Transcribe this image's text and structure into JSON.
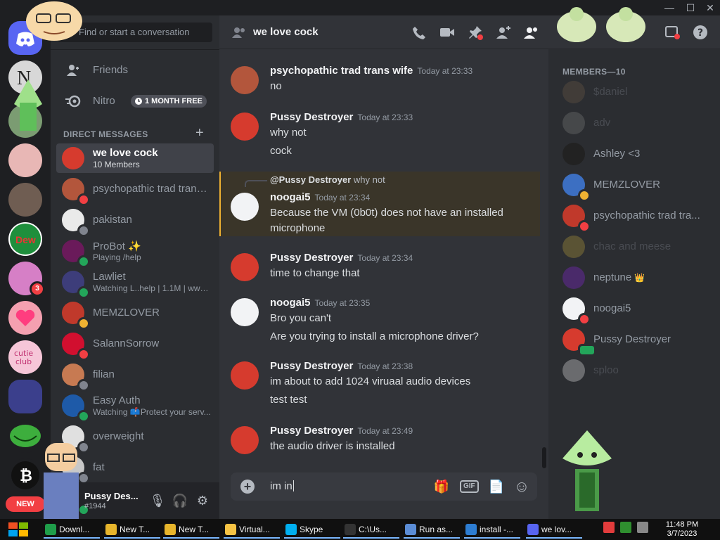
{
  "window": {
    "controls": {
      "minimize": "—",
      "maximize": "☐",
      "close": "✕"
    }
  },
  "colors": {
    "blurple": "#5865f2",
    "online": "#23a55a",
    "dnd": "#f23f43",
    "idle": "#f0b232",
    "mention_highlight": "#f0b232"
  },
  "rail": {
    "mention_badge": "3",
    "new_pill": "NEW"
  },
  "sidebar": {
    "search_placeholder": "Find or start a conversation",
    "friends_label": "Friends",
    "nitro_label": "Nitro",
    "nitro_pill": "1 MONTH FREE",
    "dm_header": "DIRECT MESSAGES",
    "dm_add": "+",
    "dms": [
      {
        "name": "we love cock",
        "sub": "10 Members",
        "active": true,
        "status": ""
      },
      {
        "name": "psychopathic trad trans wife",
        "sub": "",
        "status": "dnd"
      },
      {
        "name": "pakistan",
        "sub": "",
        "status": "offline"
      },
      {
        "name": "ProBot ✨",
        "sub": "Playing /help",
        "status": "online"
      },
      {
        "name": "Lawliet",
        "sub": "Watching L..help | 1.1M | www.l...",
        "status": "online"
      },
      {
        "name": "MEMZLOVER",
        "sub": "",
        "status": "idle"
      },
      {
        "name": "SalannSorrow",
        "sub": "",
        "status": "dnd"
      },
      {
        "name": "filian",
        "sub": "",
        "status": "offline"
      },
      {
        "name": "Easy Auth",
        "sub": "Watching 📫Protect your serv...",
        "status": "online"
      },
      {
        "name": "overweight",
        "sub": "",
        "status": "offline"
      },
      {
        "name": "fat",
        "sub": "",
        "status": "offline"
      }
    ]
  },
  "user_panel": {
    "name": "Pussy Des...",
    "tag": "#1944",
    "mic_icon": "🎙",
    "headset_icon": "🎧",
    "settings_icon": "⚙"
  },
  "chat": {
    "title": "we love cock",
    "messages": [
      {
        "author": "psychopathic trad trans wife",
        "time": "Today at 23:33",
        "lines": [
          "no"
        ]
      },
      {
        "author": "Pussy Destroyer",
        "time": "Today at 23:33",
        "lines": [
          "why not",
          "cock"
        ]
      },
      {
        "author": "noogai5",
        "time": "Today at 23:34",
        "reply_to": "@Pussy Destroyer",
        "reply_text": "why not",
        "lines": [
          "Because the VM (0b0t) does not have an installed microphone"
        ]
      },
      {
        "author": "Pussy Destroyer",
        "time": "Today at 23:34",
        "lines": [
          "time to change that"
        ]
      },
      {
        "author": "noogai5",
        "time": "Today at 23:35",
        "lines": [
          "Bro you can't",
          "Are you trying to install a microphone driver?"
        ]
      },
      {
        "author": "Pussy Destroyer",
        "time": "Today at 23:38",
        "lines": [
          "im about to add 1024 viruaal audio devices",
          "test test"
        ]
      },
      {
        "author": "Pussy Destroyer",
        "time": "Today at 23:49",
        "lines": [
          "the audio driver is installed"
        ]
      }
    ],
    "composer": {
      "value": "im in",
      "gif_label": "GIF",
      "add_icon": "+",
      "gift_icon": "🎁",
      "sticker_icon": "📄",
      "emoji_icon": "☺"
    }
  },
  "members": {
    "title": "MEMBERS—10",
    "list": [
      {
        "name": "$daniel",
        "status": "offline"
      },
      {
        "name": "adv",
        "status": "offline"
      },
      {
        "name": "Ashley <3",
        "status": "online-none"
      },
      {
        "name": "MEMZLOVER",
        "status": "idle"
      },
      {
        "name": "psychopathic trad tra...",
        "status": "dnd"
      },
      {
        "name": "chac and meese",
        "status": "offline"
      },
      {
        "name": "neptune",
        "status": "online-none",
        "crown": "👑"
      },
      {
        "name": "noogai5",
        "status": "dnd"
      },
      {
        "name": "Pussy Destroyer",
        "status": "online-typing"
      },
      {
        "name": "sploo",
        "status": "offline"
      }
    ]
  },
  "taskbar": {
    "items": [
      {
        "label": "Downl...",
        "color": "#1f9e4a"
      },
      {
        "label": "New T...",
        "color": "#e7b52c"
      },
      {
        "label": "New T...",
        "color": "#e7b52c"
      },
      {
        "label": "Virtual...",
        "color": "#f6c344"
      },
      {
        "label": "Skype",
        "color": "#00aff0"
      },
      {
        "label": "C:\\Us...",
        "color": "#333333"
      },
      {
        "label": "Run as...",
        "color": "#5b8dd6"
      },
      {
        "label": "install -...",
        "color": "#2d7dd2"
      },
      {
        "label": "we lov...",
        "color": "#5865f2"
      }
    ],
    "time": "11:48 PM",
    "date": "3/7/2023"
  }
}
